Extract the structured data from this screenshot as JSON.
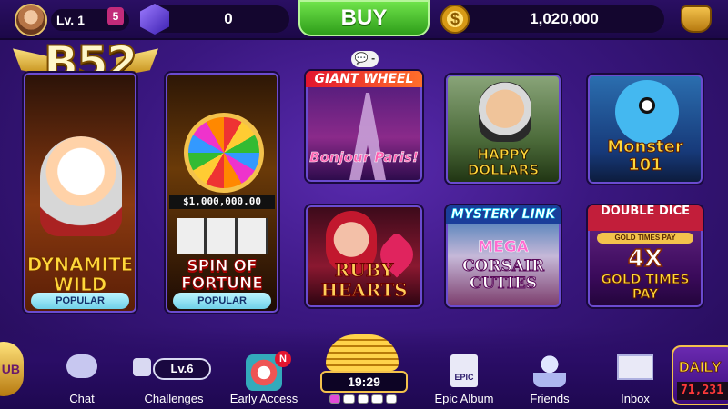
{
  "header": {
    "level_label": "Lv. 1",
    "level_badge": "5",
    "gems": "0",
    "buy_label": "BUY",
    "coins": "1,020,000"
  },
  "logo": {
    "text": "B52"
  },
  "games": {
    "dynamite": {
      "title": "DYNAMITE WILD",
      "tag": "POPULAR"
    },
    "spin": {
      "jackpot": "$1,000,000.00",
      "title": "SPIN OF FORTUNE",
      "tag": "POPULAR"
    },
    "giant": {
      "banner": "GIANT WHEEL",
      "title": "Bonjour Paris!",
      "notify": "💬 -"
    },
    "happy": {
      "title": "HAPPY DOLLARS"
    },
    "monster": {
      "title": "Monster 101"
    },
    "ruby": {
      "title": "RUBY HEARTS"
    },
    "corsair": {
      "banner": "MYSTERY LINK",
      "mid": "MEGA",
      "title": "CORSAIR CUTIES"
    },
    "dice": {
      "banner": "DOUBLE DICE",
      "strip": "GOLD TIMES PAY",
      "mult": "4X",
      "title": "GOLD TIMES PAY"
    }
  },
  "nav": {
    "club_label": "UB",
    "chat": "Chat",
    "challenges": "Challenges",
    "challenges_level": "Lv.6",
    "early_access": "Early Access",
    "early_badge": "N",
    "timer": "19:29",
    "epic_icon_text": "EPIC",
    "epic_album": "Epic Album",
    "friends": "Friends",
    "inbox": "Inbox",
    "daily_label": "DAILY",
    "daily_value": "71,231"
  }
}
